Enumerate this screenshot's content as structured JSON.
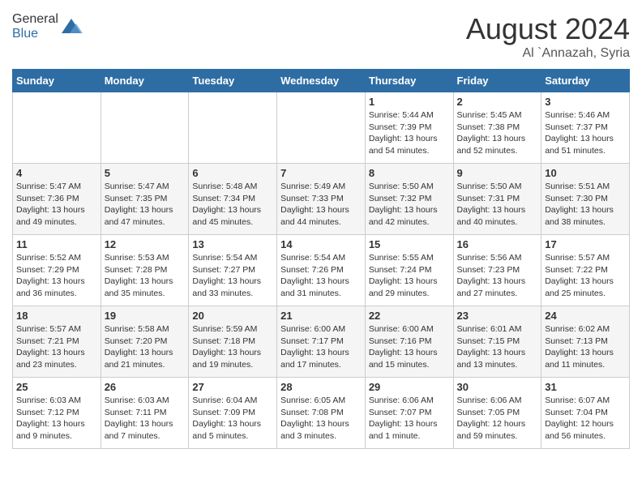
{
  "header": {
    "logo_general": "General",
    "logo_blue": "Blue",
    "month_title": "August 2024",
    "location": "Al `Annazah, Syria"
  },
  "days_of_week": [
    "Sunday",
    "Monday",
    "Tuesday",
    "Wednesday",
    "Thursday",
    "Friday",
    "Saturday"
  ],
  "weeks": [
    [
      {
        "day": "",
        "info": ""
      },
      {
        "day": "",
        "info": ""
      },
      {
        "day": "",
        "info": ""
      },
      {
        "day": "",
        "info": ""
      },
      {
        "day": "1",
        "info": "Sunrise: 5:44 AM\nSunset: 7:39 PM\nDaylight: 13 hours\nand 54 minutes."
      },
      {
        "day": "2",
        "info": "Sunrise: 5:45 AM\nSunset: 7:38 PM\nDaylight: 13 hours\nand 52 minutes."
      },
      {
        "day": "3",
        "info": "Sunrise: 5:46 AM\nSunset: 7:37 PM\nDaylight: 13 hours\nand 51 minutes."
      }
    ],
    [
      {
        "day": "4",
        "info": "Sunrise: 5:47 AM\nSunset: 7:36 PM\nDaylight: 13 hours\nand 49 minutes."
      },
      {
        "day": "5",
        "info": "Sunrise: 5:47 AM\nSunset: 7:35 PM\nDaylight: 13 hours\nand 47 minutes."
      },
      {
        "day": "6",
        "info": "Sunrise: 5:48 AM\nSunset: 7:34 PM\nDaylight: 13 hours\nand 45 minutes."
      },
      {
        "day": "7",
        "info": "Sunrise: 5:49 AM\nSunset: 7:33 PM\nDaylight: 13 hours\nand 44 minutes."
      },
      {
        "day": "8",
        "info": "Sunrise: 5:50 AM\nSunset: 7:32 PM\nDaylight: 13 hours\nand 42 minutes."
      },
      {
        "day": "9",
        "info": "Sunrise: 5:50 AM\nSunset: 7:31 PM\nDaylight: 13 hours\nand 40 minutes."
      },
      {
        "day": "10",
        "info": "Sunrise: 5:51 AM\nSunset: 7:30 PM\nDaylight: 13 hours\nand 38 minutes."
      }
    ],
    [
      {
        "day": "11",
        "info": "Sunrise: 5:52 AM\nSunset: 7:29 PM\nDaylight: 13 hours\nand 36 minutes."
      },
      {
        "day": "12",
        "info": "Sunrise: 5:53 AM\nSunset: 7:28 PM\nDaylight: 13 hours\nand 35 minutes."
      },
      {
        "day": "13",
        "info": "Sunrise: 5:54 AM\nSunset: 7:27 PM\nDaylight: 13 hours\nand 33 minutes."
      },
      {
        "day": "14",
        "info": "Sunrise: 5:54 AM\nSunset: 7:26 PM\nDaylight: 13 hours\nand 31 minutes."
      },
      {
        "day": "15",
        "info": "Sunrise: 5:55 AM\nSunset: 7:24 PM\nDaylight: 13 hours\nand 29 minutes."
      },
      {
        "day": "16",
        "info": "Sunrise: 5:56 AM\nSunset: 7:23 PM\nDaylight: 13 hours\nand 27 minutes."
      },
      {
        "day": "17",
        "info": "Sunrise: 5:57 AM\nSunset: 7:22 PM\nDaylight: 13 hours\nand 25 minutes."
      }
    ],
    [
      {
        "day": "18",
        "info": "Sunrise: 5:57 AM\nSunset: 7:21 PM\nDaylight: 13 hours\nand 23 minutes."
      },
      {
        "day": "19",
        "info": "Sunrise: 5:58 AM\nSunset: 7:20 PM\nDaylight: 13 hours\nand 21 minutes."
      },
      {
        "day": "20",
        "info": "Sunrise: 5:59 AM\nSunset: 7:18 PM\nDaylight: 13 hours\nand 19 minutes."
      },
      {
        "day": "21",
        "info": "Sunrise: 6:00 AM\nSunset: 7:17 PM\nDaylight: 13 hours\nand 17 minutes."
      },
      {
        "day": "22",
        "info": "Sunrise: 6:00 AM\nSunset: 7:16 PM\nDaylight: 13 hours\nand 15 minutes."
      },
      {
        "day": "23",
        "info": "Sunrise: 6:01 AM\nSunset: 7:15 PM\nDaylight: 13 hours\nand 13 minutes."
      },
      {
        "day": "24",
        "info": "Sunrise: 6:02 AM\nSunset: 7:13 PM\nDaylight: 13 hours\nand 11 minutes."
      }
    ],
    [
      {
        "day": "25",
        "info": "Sunrise: 6:03 AM\nSunset: 7:12 PM\nDaylight: 13 hours\nand 9 minutes."
      },
      {
        "day": "26",
        "info": "Sunrise: 6:03 AM\nSunset: 7:11 PM\nDaylight: 13 hours\nand 7 minutes."
      },
      {
        "day": "27",
        "info": "Sunrise: 6:04 AM\nSunset: 7:09 PM\nDaylight: 13 hours\nand 5 minutes."
      },
      {
        "day": "28",
        "info": "Sunrise: 6:05 AM\nSunset: 7:08 PM\nDaylight: 13 hours\nand 3 minutes."
      },
      {
        "day": "29",
        "info": "Sunrise: 6:06 AM\nSunset: 7:07 PM\nDaylight: 13 hours\nand 1 minute."
      },
      {
        "day": "30",
        "info": "Sunrise: 6:06 AM\nSunset: 7:05 PM\nDaylight: 12 hours\nand 59 minutes."
      },
      {
        "day": "31",
        "info": "Sunrise: 6:07 AM\nSunset: 7:04 PM\nDaylight: 12 hours\nand 56 minutes."
      }
    ]
  ]
}
